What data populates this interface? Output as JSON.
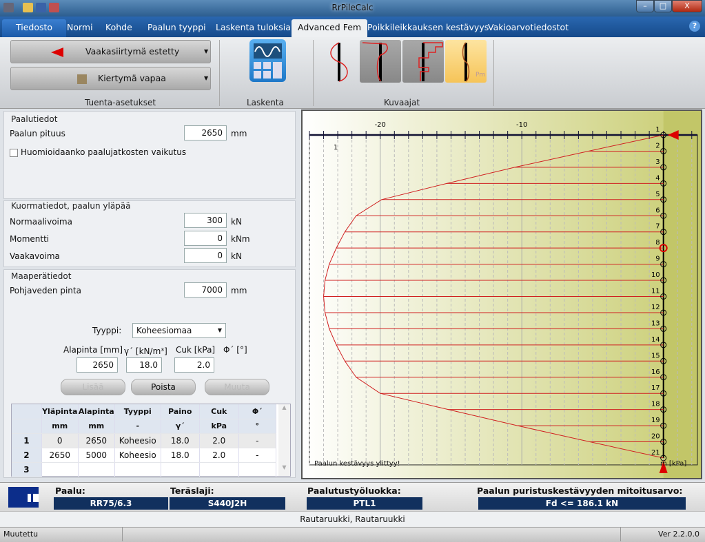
{
  "app": {
    "title": "RrPileCalc"
  },
  "quick_access": [
    {
      "icon": "tools-icon"
    },
    {
      "icon": "folder-open-icon"
    },
    {
      "icon": "save-icon"
    },
    {
      "icon": "print-icon"
    }
  ],
  "window_controls": {
    "minimize": "–",
    "maximize": "□",
    "close": "X"
  },
  "tabs": [
    {
      "label": "Tiedosto"
    },
    {
      "label": "Normi"
    },
    {
      "label": "Kohde"
    },
    {
      "label": "Paalun tyyppi"
    },
    {
      "label": "Laskenta tuloksia"
    },
    {
      "label": "Advanced Fem"
    },
    {
      "label": "Poikkileikkauksen kestävyys"
    },
    {
      "label": "Vakioarvotiedostot"
    }
  ],
  "active_tab": "Advanced Fem",
  "help": "?",
  "ribbon": {
    "support": {
      "horizontal": "Vaakasiirtymä estetty",
      "rotation": "Kiertymä vapaa",
      "group": "Tuenta-asetukset"
    },
    "calc": {
      "group": "Laskenta"
    },
    "graphs": {
      "group": "Kuvaajat",
      "items": [
        {
          "name": "displacement"
        },
        {
          "name": "moment"
        },
        {
          "name": "shear"
        },
        {
          "name": "soil-pressure",
          "label": "Pm",
          "active": true
        }
      ]
    }
  },
  "pile": {
    "header": "Paalutiedot",
    "length_label": "Paalun pituus",
    "length": "2650",
    "length_unit": "mm",
    "joint_label": "Huomioidaanko paalujatkosten vaikutus",
    "joint_checked": false
  },
  "loads": {
    "header": "Kuormatiedot, paalun yläpää",
    "normal_label": "Normaalivoima",
    "normal": "300",
    "normal_unit": "kN",
    "moment_label": "Momentti",
    "moment": "0",
    "moment_unit": "kNm",
    "shear_label": "Vaakavoima",
    "shear": "0",
    "shear_unit": "kN"
  },
  "soil": {
    "header": "Maaperätiedot",
    "gw_label": "Pohjaveden pinta",
    "gw": "7000",
    "gw_unit": "mm",
    "type_label": "Tyyppi:",
    "type": "Koheesiomaa",
    "bottom_label": "Alapinta [mm]",
    "gamma_label": "γ´ [kN/m³]",
    "cuk_label": "Cuk [kPa]",
    "phi_label": "Φ´ [°]",
    "bottom": "2650",
    "gamma": "18.0",
    "cuk": "2.0",
    "add": "Lisää",
    "remove": "Poista",
    "edit": "Muuta",
    "table": {
      "headers": [
        "",
        "Yläpinta",
        "Alapinta",
        "Tyyppi",
        "Paino",
        "Cuk",
        "Φ´"
      ],
      "units": [
        "",
        "mm",
        "mm",
        "-",
        "γ´",
        "kPa",
        "°"
      ],
      "rows": [
        [
          "1",
          "0",
          "2650",
          "Koheesio",
          "18.0",
          "2.0",
          "-"
        ],
        [
          "2",
          "2650",
          "5000",
          "Koheesio",
          "18.0",
          "2.0",
          "-"
        ],
        [
          "3",
          "",
          "",
          "",
          "",
          "",
          ""
        ]
      ]
    }
  },
  "chart": {
    "ticks": [
      "-20",
      "-10"
    ],
    "scale_label": "1",
    "unit": "m  [kPa]",
    "warning": "Paalun kestävyys ylittyy!",
    "nodes": [
      "1",
      "2",
      "3",
      "4",
      "5",
      "6",
      "7",
      "8",
      "9",
      "10",
      "11",
      "12",
      "13",
      "14",
      "15",
      "16",
      "17",
      "18",
      "19",
      "20",
      "21"
    ],
    "highlight_node": "8",
    "pressure_kpa": [
      0,
      -5.3,
      -10.5,
      -15.3,
      -19.9,
      -21.7,
      -22.5,
      -23.1,
      -23.6,
      -23.9,
      -24.0,
      -23.9,
      -23.6,
      -23.1,
      -22.5,
      -21.7,
      -20.0,
      -15.2,
      -10.3,
      -5.2,
      0
    ],
    "x_range": [
      -25,
      2.4
    ],
    "colors": {
      "line": "#d02020",
      "bg_start": "#ffffff",
      "bg_end": "#c8cc70"
    }
  },
  "info": {
    "pile_label": "Paalu:",
    "pile": "RR75/6.3",
    "steel_label": "Teräslaji:",
    "steel": "S440J2H",
    "class_label": "Paalutustyöluokka:",
    "class": "PTL1",
    "capacity_label": "Paalun puristuskestävyyden mitoitusarvo:",
    "capacity": "Fd <= 186.1 kN"
  },
  "company": "Rautaruukki,  Rautaruukki",
  "status": {
    "left": "Muutettu",
    "version": "Ver 2.2.0.0"
  }
}
